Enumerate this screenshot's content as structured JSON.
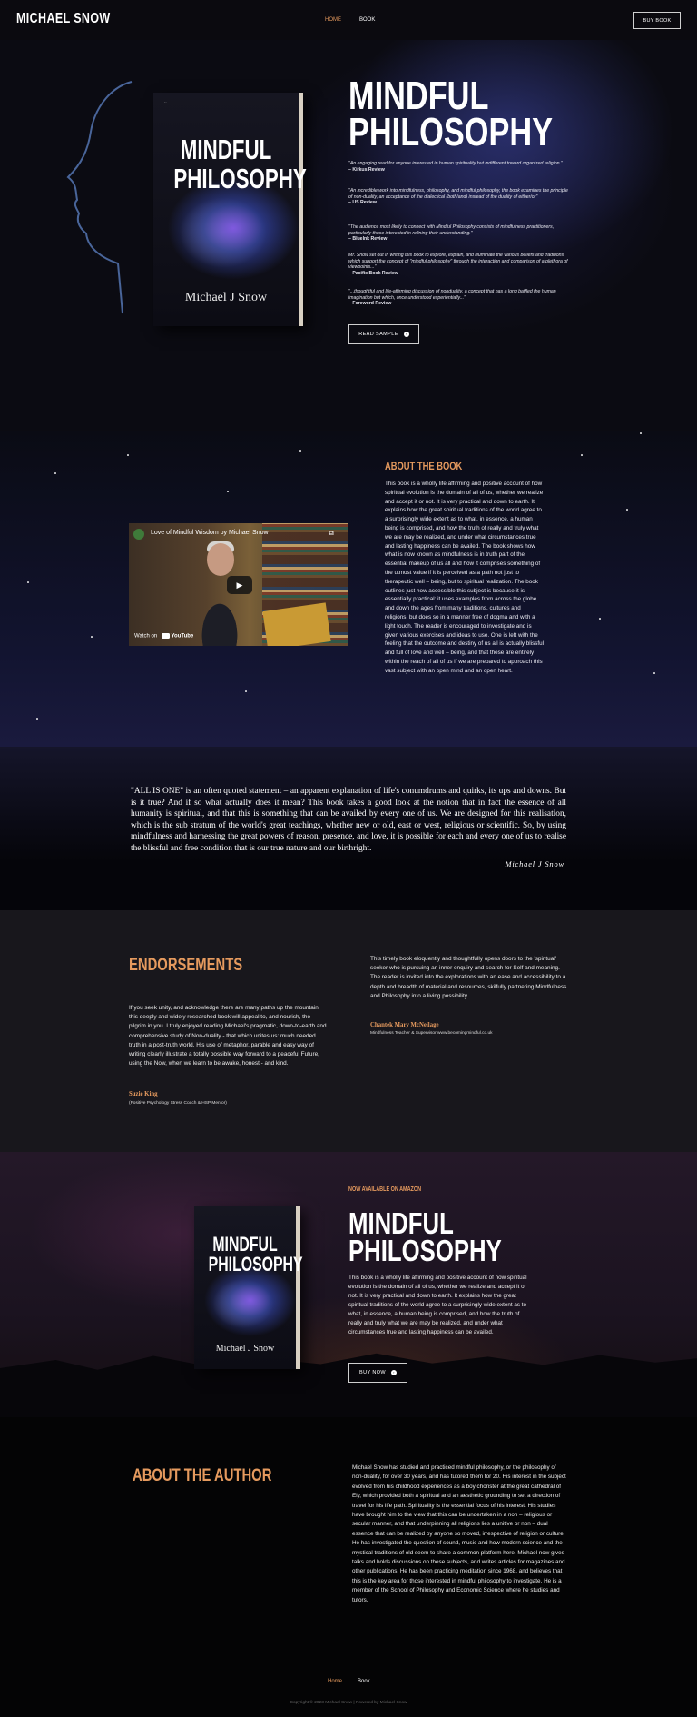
{
  "header": {
    "logo": "MICHAEL SNOW",
    "nav": [
      {
        "label": "HOME"
      },
      {
        "label": "BOOK"
      }
    ],
    "cta": "BUY BOOK"
  },
  "book_cover": {
    "title_line1": "MINDFUL",
    "title_line2": "PHILOSOPHY",
    "author": "Michael J Snow"
  },
  "hero": {
    "title_line1": "MINDFUL",
    "title_line2": "PHILOSOPHY",
    "quotes": [
      {
        "text": "\"An engaging read for anyone interested in human spirituality but indifferent toward organized religion.\"",
        "source": "– Kirkus Review"
      },
      {
        "text": "\"An incredible work into mindfulness, philosophy, and mindful philosophy, the book examines the principle of non-duality, an acceptance of the dialectical (both/and) instead of the duality of either/or\"",
        "source": "– US Review"
      },
      {
        "text": "\"The audience most likely to connect with Mindful Philosophy consists of mindfulness practitioners, particularly those interested in refining their understanding.\"",
        "source": "– Bluelnk Review"
      },
      {
        "text": "Mr. Snow set out in writing this book to explore, explain, and illuminate the various beliefs and traditions which support the concept of \"mindful philosophy\" through the interaction and comparison of a plethora of viewpoints...\"",
        "source": "– Pacific Book Review"
      },
      {
        "text": "\"...thoughtful and life-affirming discussion of nonduality, a concept that has a long baffled the human imagination but which, once understood experientially...\"",
        "source": "– Foreword Review"
      }
    ],
    "read_button": "READ SAMPLE"
  },
  "about_book": {
    "heading": "ABOUT THE BOOK",
    "video": {
      "title": "Love of Mindful Wisdom by Michael Snow",
      "watch_label": "Watch on",
      "platform": "YouTube"
    },
    "body": "This book is a wholly life affirming and positive account of how spiritual evolution is the domain of all of us, whether we realize and accept it or not. It is very practical and down to earth. It explains how the great spiritual traditions of the world agree to a surprisingly wide extent as to what, in essence, a human being is comprised, and how the truth of really and truly what we are may be realized, and under what circumstances true and lasting happiness can be availed. The book shows how what is now known as mindfulness is in truth part of the essential makeup of us all and how it comprises something of the utmost value if it is perceived as a path not just to therapeutic well – being, but to spiritual realization. The book outlines just how accessible this subject is because it is essentially practical: it uses examples from across the globe and down the ages from many traditions, cultures and religions, but does so in a manner free of dogma and with a light touch. The reader is encouraged to investigate and is given various exercises and ideas to use. One is left with the feeling that the outcome and destiny of us all is actually blissful and full of love and well – being, and that these are entirely within the reach of all of us if we are prepared to approach this vast subject with an open mind and an open heart."
  },
  "quote_band": {
    "text": "\"ALL IS ONE\" is an often quoted statement – an apparent explanation of life's conumdrums and quirks, its ups and downs. But is it true? And if so what actually does it mean? This book takes a good look at the notion that in fact the essence of all humanity is spiritual, and that this is something that can be availed by every one of us. We are designed for this realisation, which is the sub stratum of the world's great teachings, whether new or old, east or west, religious or scientific. So, by using mindfulness and harnessing the great powers of reason, presence, and love, it is possible for each and every one of us to realise the blissful and free condition that is our true nature and our birthright.",
    "signature": "Michael J Snow"
  },
  "endorsements": {
    "heading": "ENDORSEMENTS",
    "items": [
      {
        "text": "If you seek unity, and acknowledge there are many paths up the mountain, this deeply and widely researched book will appeal to, and nourish, the pilgrim in you. I truly enjoyed reading Michael's pragmatic, down-to-earth and comprehensive study of Non-duality - that which unites us: much needed truth in a post-truth world. His use of metaphor, parable and easy way of writing clearly illustrate a totally possible way forward to a peaceful Future, using the Now, when we learn to be awake, honest - and kind.",
        "name": "Suzie King",
        "role": "(Positive Psychology Stress Coach & HSP Mentor)"
      },
      {
        "text": "This timely book eloquently and thoughtfully opens doors to the 'spiritual' seeker who is pursuing an inner enquiry and search for Self and meaning. The reader is invited into the explorations with an ease and accessibility to a depth and breadth of material and resources, skilfully partnering Mindfulness and Philosophy into a living possibility.",
        "name": "Chantek Mary McNeilage",
        "role": "Mindfulness Teacher & Supervisor www.becomingmindful.co.uk"
      }
    ]
  },
  "available": {
    "label": "NOW AVAILABLE ON AMAZON",
    "title_line1": "MINDFUL",
    "title_line2": "PHILOSOPHY",
    "body": "This book is a wholly life affirming and positive account of how spiritual evolution is the domain of all of us, whether we realize and accept it or not. It is very practical and down to earth. It explains how the great spiritual traditions of the world agree to a surprisingly wide extent as to what, in essence, a human being is comprised, and how the truth of really and truly what we are may be realized, and under what circumstances true and lasting happiness can be availed.",
    "button": "BUY NOW"
  },
  "author": {
    "heading": "ABOUT THE AUTHOR",
    "body": "Michael Snow has studied and practiced mindful philosophy, or the philosophy of non-duality, for over 30 years, and has tutored them for 20. His interest in the subject evolved from his childhood experiences as a boy chorister at the great cathedral of Ely, which provided both a spiritual and an aesthetic grounding to set a direction of travel for his life path. Spirituality is the essential focus of his interest. His studies have brought him to the view that this can be undertaken in a non – religious or secular manner, and that underpinning all religions lies a unitive or non – dual essence that can be realized by anyone so moved, irrespective of religion or culture. He has investigated the question of sound, music and how modern science and the mystical traditions of old seem to share a common platform here. Michael now gives talks and holds discussions on these subjects, and writes articles for magazines and other publications. He has been practicing meditation since 1968, and believes that this is the key area for those interested in mindful philosophy to investigate. He is a member of the School of Philosophy and Economic Science where he studies and tutors."
  },
  "footer": {
    "nav": [
      {
        "label": "Home"
      },
      {
        "label": "Book"
      }
    ],
    "copyright": "Copyright © 2023 Michael Snow | Powered by Michael Snow"
  },
  "colors": {
    "accent": "#e59a5e",
    "background": "#0a0a0e",
    "endorse_bg": "#18171c"
  }
}
